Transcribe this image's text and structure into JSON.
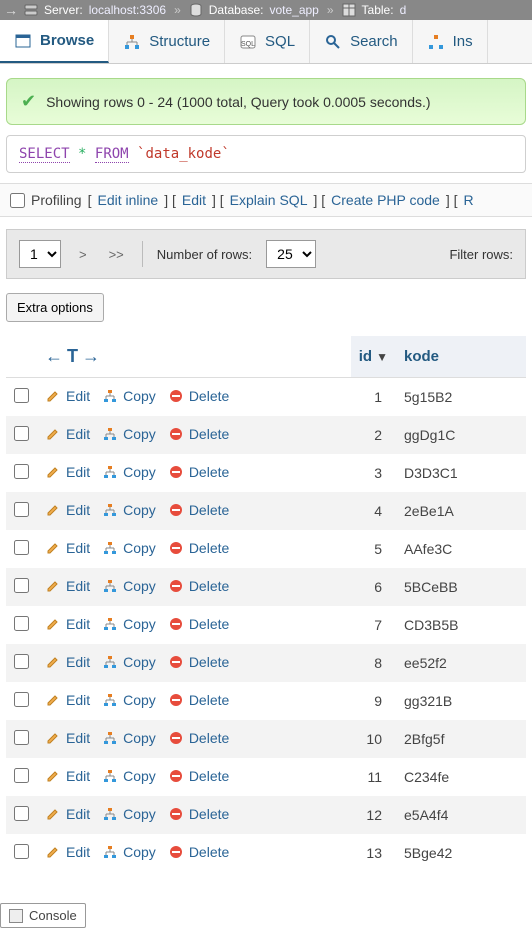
{
  "crumb": {
    "server_label": "Server:",
    "server_value": "localhost:3306",
    "db_label": "Database:",
    "db_value": "vote_app",
    "table_label": "Table:",
    "table_value": "d"
  },
  "tabs": {
    "browse": "Browse",
    "structure": "Structure",
    "sql": "SQL",
    "search": "Search",
    "insert": "Ins"
  },
  "success_msg": "Showing rows 0 - 24 (1000 total, Query took 0.0005 seconds.)",
  "sql": {
    "select": "SELECT",
    "star": "*",
    "from": "FROM",
    "table": "`data_kode`"
  },
  "prof": {
    "profiling": "Profiling",
    "edit_inline": "Edit inline",
    "edit": "Edit",
    "explain": "Explain SQL",
    "php": "Create PHP code",
    "r": "R"
  },
  "nav": {
    "page": "1",
    "next": ">",
    "last": ">>",
    "rows_label": "Number of rows:",
    "rows": "25",
    "filter": "Filter rows:"
  },
  "extra_btn": "Extra options",
  "table": {
    "col_id": "id",
    "col_kode": "kode",
    "edit": "Edit",
    "copy": "Copy",
    "delete": "Delete",
    "rows": [
      {
        "id": "1",
        "kode": "5g15B2"
      },
      {
        "id": "2",
        "kode": "ggDg1C"
      },
      {
        "id": "3",
        "kode": "D3D3C1"
      },
      {
        "id": "4",
        "kode": "2eBe1A"
      },
      {
        "id": "5",
        "kode": "AAfe3C"
      },
      {
        "id": "6",
        "kode": "5BCeBB"
      },
      {
        "id": "7",
        "kode": "CD3B5B"
      },
      {
        "id": "8",
        "kode": "ee52f2"
      },
      {
        "id": "9",
        "kode": "gg321B"
      },
      {
        "id": "10",
        "kode": "2Bfg5f"
      },
      {
        "id": "11",
        "kode": "C234fe"
      },
      {
        "id": "12",
        "kode": "e5A4f4"
      },
      {
        "id": "13",
        "kode": "5Bge42"
      }
    ]
  },
  "console": "Console"
}
